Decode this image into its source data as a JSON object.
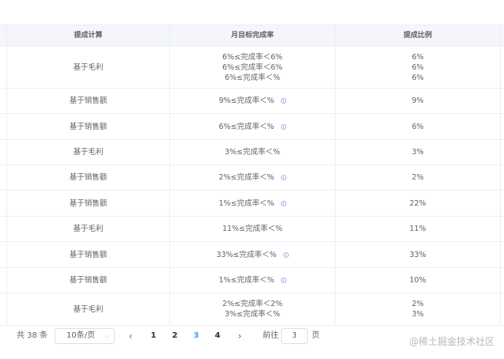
{
  "table": {
    "headers": [
      "提成计算",
      "月目标完成率",
      "提成比例"
    ],
    "rows": [
      {
        "calc": "基于毛利",
        "rates": [
          "6%≤完成率＜6%",
          "6%≤完成率＜6%",
          "6%≤完成率＜%"
        ],
        "info": false,
        "ratios": [
          "6%",
          "6%",
          "6%"
        ]
      },
      {
        "calc": "基于销售额",
        "rates": [
          "9%≤完成率＜%"
        ],
        "info": true,
        "ratios": [
          "9%"
        ]
      },
      {
        "calc": "基于销售额",
        "rates": [
          "6%≤完成率＜%"
        ],
        "info": true,
        "ratios": [
          "6%"
        ]
      },
      {
        "calc": "基于毛利",
        "rates": [
          "3%≤完成率＜%"
        ],
        "info": false,
        "ratios": [
          "3%"
        ]
      },
      {
        "calc": "基于销售额",
        "rates": [
          "2%≤完成率＜%"
        ],
        "info": true,
        "ratios": [
          "2%"
        ]
      },
      {
        "calc": "基于销售额",
        "rates": [
          "1%≤完成率＜%"
        ],
        "info": true,
        "ratios": [
          "22%"
        ]
      },
      {
        "calc": "基于毛利",
        "rates": [
          "11%≤完成率＜%"
        ],
        "info": false,
        "ratios": [
          "11%"
        ]
      },
      {
        "calc": "基于销售额",
        "rates": [
          "33%≤完成率＜%"
        ],
        "info": true,
        "ratios": [
          "33%"
        ]
      },
      {
        "calc": "基于销售额",
        "rates": [
          "1%≤完成率＜%"
        ],
        "info": true,
        "ratios": [
          "10%"
        ]
      },
      {
        "calc": "基于毛利",
        "rates": [
          "2%≤完成率＜2%",
          "3%≤完成率＜%"
        ],
        "info": false,
        "ratios": [
          "2%",
          "3%"
        ]
      }
    ]
  },
  "pagination": {
    "total": "共 38 条",
    "page_size": "10条/页",
    "pages": [
      "1",
      "2",
      "3",
      "4"
    ],
    "current_page": "3",
    "jump_label_before": "前往",
    "jump_value": "3",
    "jump_label_after": "页",
    "prev_icon": "chevron-left-icon",
    "next_icon": "chevron-right-icon"
  },
  "watermark": "@稀土掘金技术社区",
  "colors": {
    "accent": "#409eff",
    "header_bg": "#f4f6fb",
    "border": "#ebeef5",
    "info_icon": "#9db6e8"
  }
}
